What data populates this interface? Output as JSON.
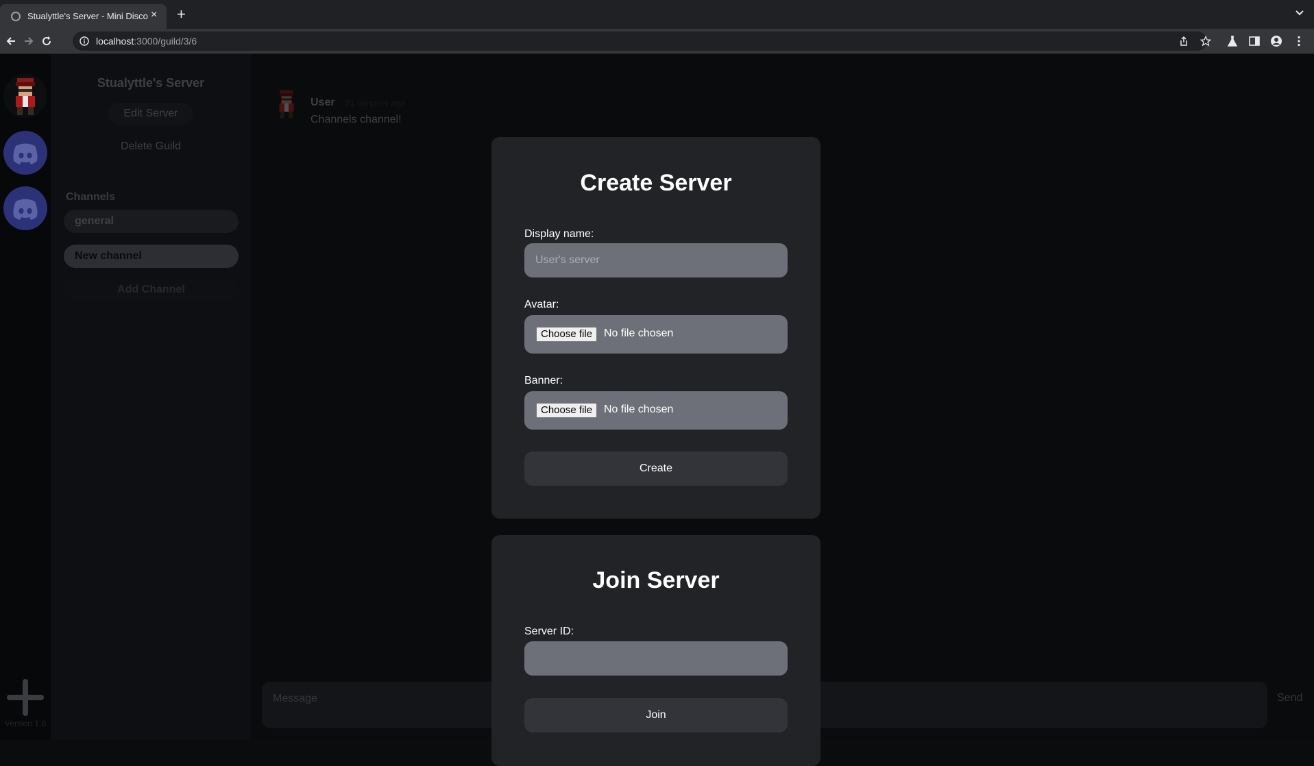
{
  "browser": {
    "tab_title": "Stualyttle's Server - Mini Discord",
    "url_host": "localhost",
    "url_path": ":3000/guild/3/6"
  },
  "rail": {
    "version": "Version 1.0"
  },
  "channel_panel": {
    "guild_name": "Stualyttle's Server",
    "edit_server": "Edit Server",
    "delete_guild": "Delete Guild",
    "channels_heading": "Channels",
    "channels": [
      {
        "label": "general"
      },
      {
        "label": "New channel"
      }
    ],
    "add_channel": "Add Channel"
  },
  "chat": {
    "message": {
      "author": "User",
      "time": "21 minutes ago",
      "text": "Channels channel!"
    },
    "composer_placeholder": "Message",
    "send_label": "Send"
  },
  "create_modal": {
    "title": "Create Server",
    "display_name_label": "Display name:",
    "display_name_placeholder": "User's server",
    "avatar_label": "Avatar:",
    "banner_label": "Banner:",
    "choose_file": "Choose file",
    "no_file": "No file chosen",
    "create_button": "Create"
  },
  "join_modal": {
    "title": "Join Server",
    "server_id_label": "Server ID:",
    "server_id_value": "",
    "join_button": "Join"
  }
}
